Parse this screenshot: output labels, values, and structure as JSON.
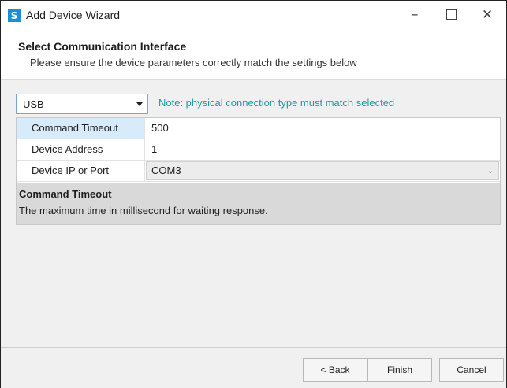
{
  "window": {
    "title": "Add Device Wizard",
    "icon_glyph": "S",
    "minimize_glyph": "–",
    "close_glyph": "✕"
  },
  "header": {
    "title": "Select Communication Interface",
    "subtitle": "Please ensure the device parameters correctly match the settings below"
  },
  "interface": {
    "selected": "USB",
    "note": "Note: physical connection type must match selected"
  },
  "properties": [
    {
      "label": "Command Timeout",
      "value": "500"
    },
    {
      "label": "Device Address",
      "value": "1"
    },
    {
      "label": "Device IP or Port",
      "value": "COM3"
    }
  ],
  "description": {
    "title": "Command Timeout",
    "text": "The maximum time in millisecond for waiting response."
  },
  "footer": {
    "back_label": "< Back",
    "finish_label": "Finish",
    "cancel_label": "Cancel"
  },
  "colors": {
    "note": "#1a9aa0",
    "selected_row": "#d8ebfb",
    "app_icon": "#1a8fd6"
  }
}
